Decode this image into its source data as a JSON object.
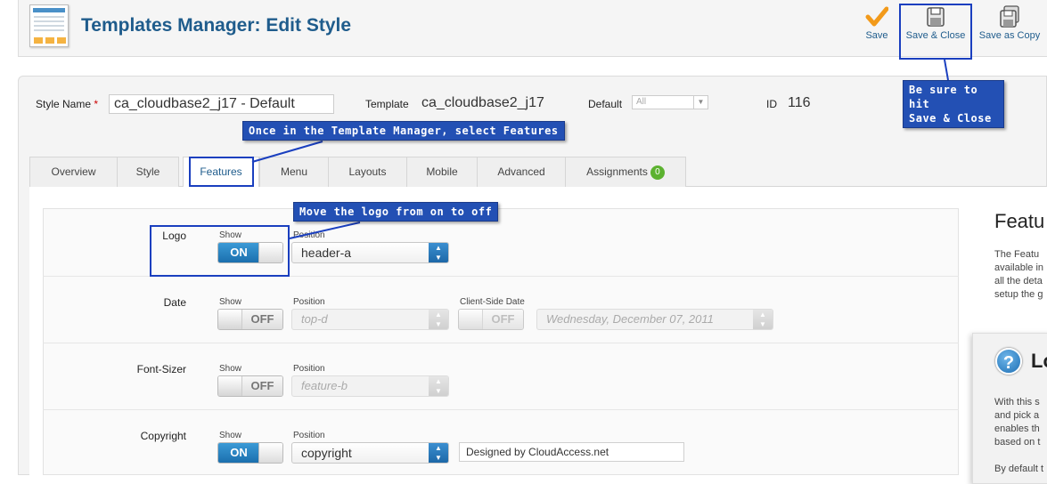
{
  "header": {
    "title": "Templates Manager: Edit Style",
    "buttons": {
      "save": "Save",
      "save_close": "Save & Close",
      "save_copy": "Save as Copy"
    }
  },
  "callouts": {
    "save_close": [
      "Be sure to hit",
      "Save & Close"
    ],
    "features": "Once in the Template Manager, select Features",
    "logo": "Move the logo from on to off"
  },
  "style": {
    "name_label": "Style Name",
    "required_mark": "*",
    "name_value": "ca_cloudbase2_j17 - Default",
    "template_label": "Template",
    "template_value": "ca_cloudbase2_j17",
    "default_label": "Default",
    "default_value": "All",
    "id_label": "ID",
    "id_value": "116"
  },
  "tabs": [
    {
      "label": "Overview"
    },
    {
      "label": "Style"
    },
    {
      "label": "Features",
      "active": true
    },
    {
      "label": "Menu"
    },
    {
      "label": "Layouts"
    },
    {
      "label": "Mobile"
    },
    {
      "label": "Advanced"
    },
    {
      "label": "Assignments",
      "badge": "0"
    }
  ],
  "features": {
    "show_label": "Show",
    "position_label": "Position",
    "on_label": "ON",
    "off_label": "OFF",
    "rows": [
      {
        "name": "Logo",
        "show": "ON",
        "position": "header-a"
      },
      {
        "name": "Date",
        "show": "OFF",
        "position": "top-d",
        "client_side_label": "Client-Side Date",
        "client_side": "OFF",
        "format": "Wednesday, December 07, 2011"
      },
      {
        "name": "Font-Sizer",
        "show": "OFF",
        "position": "feature-b"
      },
      {
        "name": "Copyright",
        "show": "ON",
        "position": "copyright",
        "text": "Designed by CloudAccess.net"
      }
    ]
  },
  "help": {
    "title": "Featu",
    "lines": [
      "The Featu",
      "available in",
      "all the deta",
      "setup the g"
    ],
    "logo_title": "Lo",
    "logo_lines": [
      "With this s",
      "and pick a",
      "enables th",
      "based on t",
      "",
      "By default t"
    ]
  },
  "colors": {
    "title_blue": "#1f5c8c",
    "callout_blue": "#2350b4",
    "toggle_on": "#1b6fae",
    "badge_green": "#5cb230"
  }
}
